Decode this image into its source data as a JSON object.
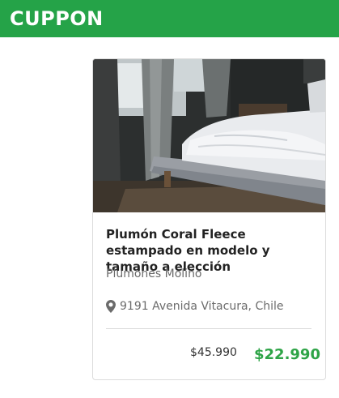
{
  "header": {
    "brand": "CUPPON",
    "brand_color": "#25a348"
  },
  "deal": {
    "image_icon": "bedroom-photo",
    "title": "Plumón Coral Fleece estampado en modelo y tamaño a elección",
    "seller": "Plumones Molino",
    "location_icon": "map-pin-icon",
    "location": "9191 Avenida Vitacura, Chile",
    "original_price": "$45.990",
    "discount_price": "$22.990",
    "price_color": "#2ea447"
  }
}
